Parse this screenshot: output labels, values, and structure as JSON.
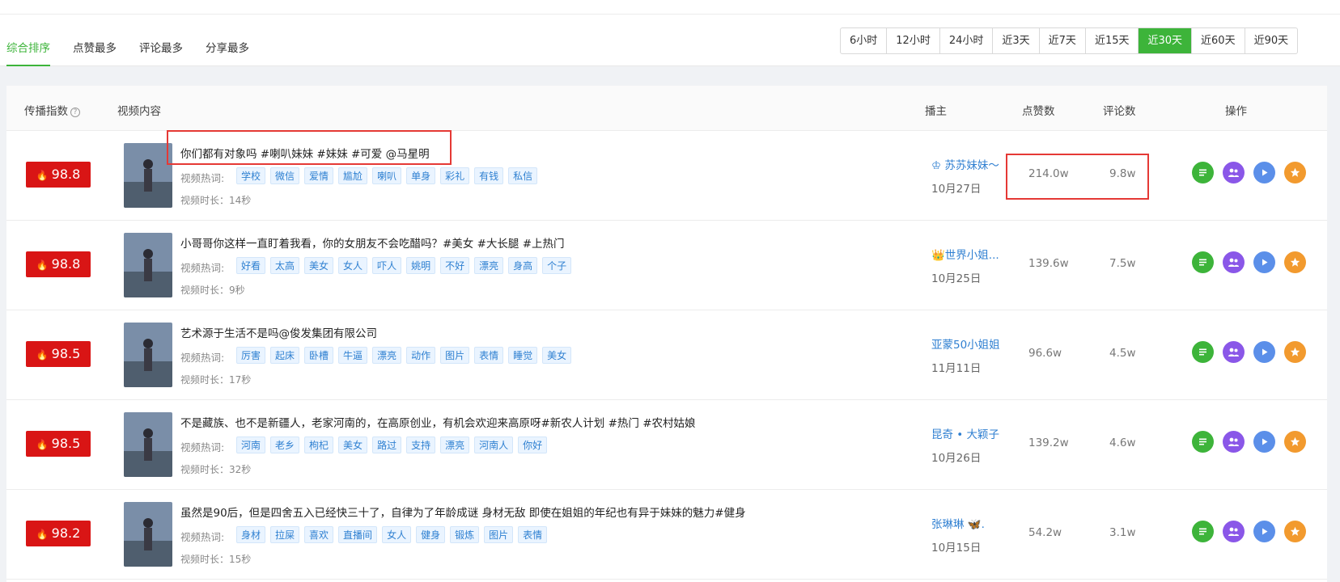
{
  "sort_tabs": [
    "综合排序",
    "点赞最多",
    "评论最多",
    "分享最多"
  ],
  "time_ranges": [
    "6小时",
    "12小时",
    "24小时",
    "近3天",
    "近7天",
    "近15天",
    "近30天",
    "近60天",
    "近90天"
  ],
  "active_time_range": "近30天",
  "columns": {
    "index": "传播指数",
    "help": "?",
    "content": "视频内容",
    "author": "播主",
    "likes": "点赞数",
    "comments": "评论数",
    "ops": "操作"
  },
  "keyword_label": "视频热词:",
  "fire_glyph": "🔥",
  "op_icons": [
    "list-icon",
    "users-icon",
    "play-icon",
    "star-icon"
  ],
  "colors": {
    "accent": "#3db43a",
    "score_bg": "#d91515",
    "tag_text": "#2f80d1",
    "highlight": "#e53935"
  },
  "rows": [
    {
      "score": "98.8",
      "title": "你们都有对象吗 #喇叭妹妹 #妹妹 #可爱 @马星明",
      "tags": [
        "学校",
        "微信",
        "爱情",
        "尴尬",
        "喇叭",
        "单身",
        "彩礼",
        "有钱",
        "私信"
      ],
      "duration": "视频时长：14秒",
      "author": "♔ 苏苏妹妹～",
      "date": "10月27日",
      "likes": "214.0w",
      "comments": "9.8w"
    },
    {
      "score": "98.8",
      "title": "小哥哥你这样一直盯着我看，你的女朋友不会吃醋吗？#美女 #大长腿 #上热门",
      "tags": [
        "好看",
        "太高",
        "美女",
        "女人",
        "吓人",
        "姚明",
        "不好",
        "漂亮",
        "身高",
        "个子"
      ],
      "duration": "视频时长：9秒",
      "author": "👑世界小姐...",
      "date": "10月25日",
      "likes": "139.6w",
      "comments": "7.5w"
    },
    {
      "score": "98.5",
      "title": "艺术源于生活不是吗@俊发集团有限公司",
      "tags": [
        "厉害",
        "起床",
        "卧槽",
        "牛逼",
        "漂亮",
        "动作",
        "图片",
        "表情",
        "睡觉",
        "美女"
      ],
      "duration": "视频时长：17秒",
      "author": "亚蒙50小姐姐",
      "date": "11月11日",
      "likes": "96.6w",
      "comments": "4.5w"
    },
    {
      "score": "98.5",
      "title": "不是藏族、也不是新疆人，老家河南的，在高原创业，有机会欢迎来高原呀#新农人计划 #热门 #农村姑娘",
      "tags": [
        "河南",
        "老乡",
        "枸杞",
        "美女",
        "路过",
        "支持",
        "漂亮",
        "河南人",
        "你好"
      ],
      "duration": "视频时长：32秒",
      "author": "昆奇 • 大颖子",
      "date": "10月26日",
      "likes": "139.2w",
      "comments": "4.6w"
    },
    {
      "score": "98.2",
      "title": "虽然是90后，但是四舍五入已经快三十了，自律为了年龄成谜 身材无敌 即使在姐姐的年纪也有异于妹妹的魅力#健身",
      "tags": [
        "身材",
        "拉屎",
        "喜欢",
        "直播间",
        "女人",
        "健身",
        "锻炼",
        "图片",
        "表情"
      ],
      "duration": "视频时长：15秒",
      "author": "张琳琳 🦋.",
      "date": "10月15日",
      "likes": "54.2w",
      "comments": "3.1w"
    }
  ]
}
